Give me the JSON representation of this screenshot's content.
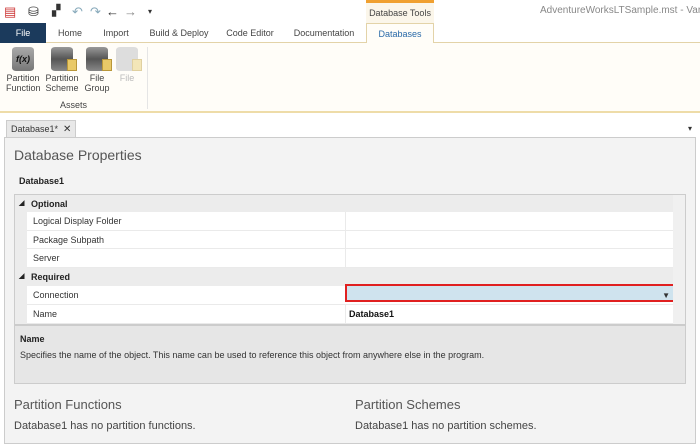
{
  "titlebar": {
    "context_tab": "Database Tools",
    "window_title": "AdventureWorksLTSample.mst - Varig",
    "icons": [
      "app-icon",
      "deploy-icon",
      "sync-icon",
      "undo-icon",
      "redo-icon",
      "back-arrow-icon",
      "forward-arrow-icon",
      "customize-icon"
    ]
  },
  "tabs": [
    "File",
    "Home",
    "Import",
    "Build & Deploy",
    "Code Editor",
    "Documentation",
    "Databases"
  ],
  "ribbon": {
    "buttons": [
      {
        "label": "Partition\nFunction",
        "l1": "Partition",
        "l2": "Function",
        "icon_text": "f(x)"
      },
      {
        "l1": "Partition",
        "l2": "Scheme"
      },
      {
        "l1": "File",
        "l2": "Group"
      },
      {
        "l1": "File",
        "l2": "",
        "disabled": true
      }
    ],
    "group": "Assets"
  },
  "doc_tab": {
    "label": "Database1*",
    "close": "✕"
  },
  "page": {
    "title": "Database Properties",
    "object": "Database1"
  },
  "grid": {
    "optional": {
      "label": "Optional",
      "props": [
        "Logical Display Folder",
        "Package Subpath",
        "Server"
      ]
    },
    "required": {
      "label": "Required",
      "connection": "Connection",
      "name_label": "Name",
      "name_value": "Database1"
    }
  },
  "description": {
    "title": "Name",
    "text": "Specifies the name of the object.  This name can be used to reference this object from anywhere else in the program."
  },
  "sections": {
    "pf_title": "Partition Functions",
    "pf_text": "Database1 has no partition functions.",
    "ps_title": "Partition Schemes",
    "ps_text": "Database1 has no partition schemes."
  },
  "colors": {
    "file_tab": "#1b3a5c",
    "highlight_border": "#e02020",
    "selected_value": "#cfe3ee"
  }
}
